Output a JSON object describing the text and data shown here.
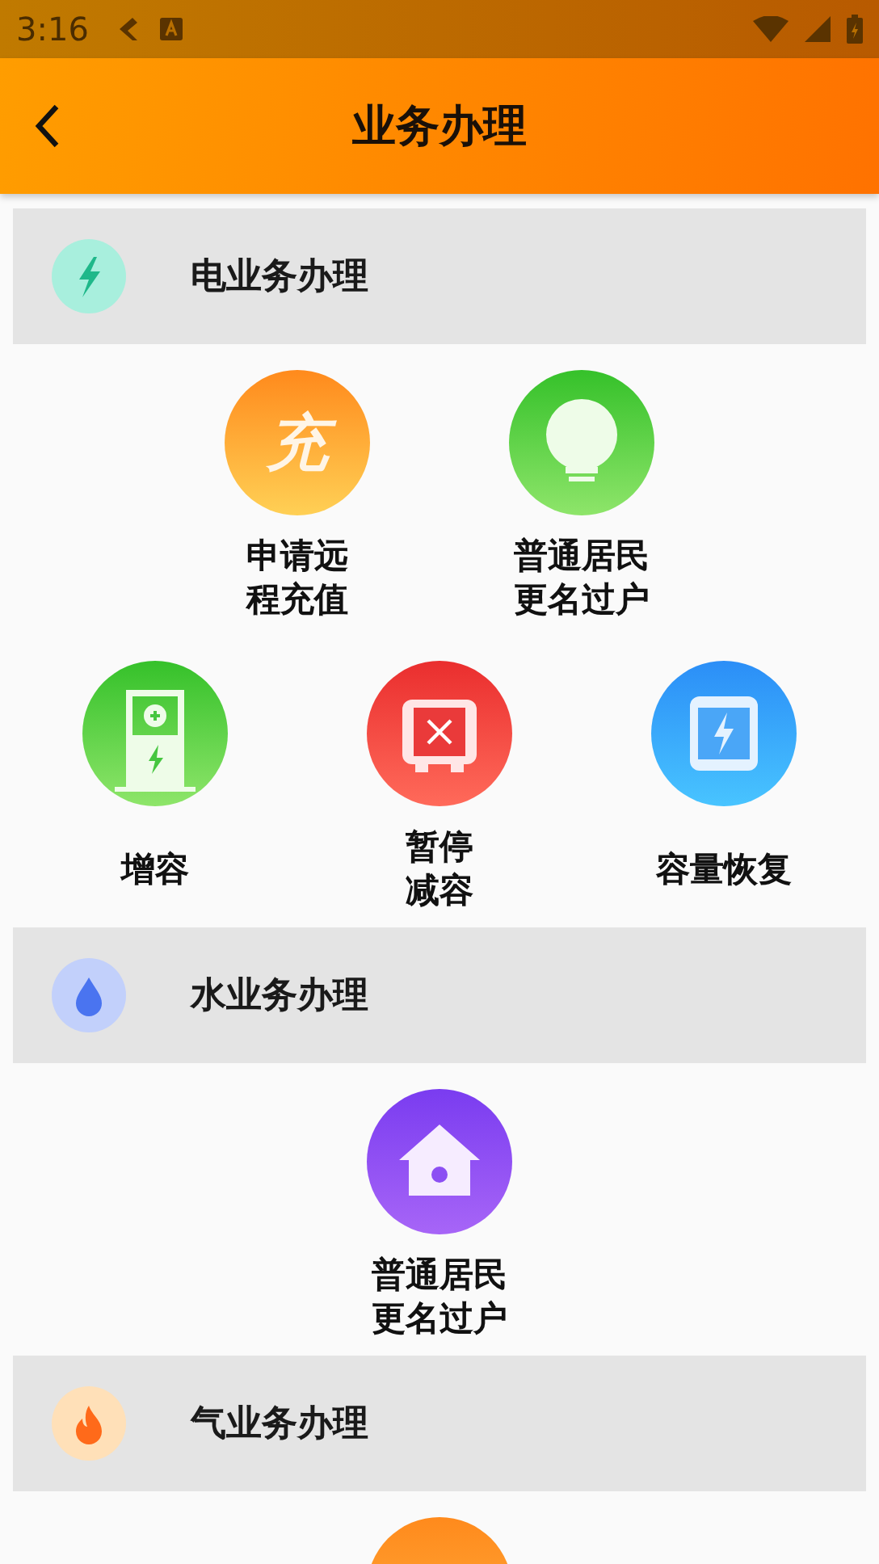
{
  "status_bar": {
    "time": "3:16"
  },
  "app_bar": {
    "title": "业务办理"
  },
  "sections": [
    {
      "title": "电业务办理",
      "kind": "bolt",
      "color": "#1fb88a",
      "rows": [
        [
          {
            "label": "申请远程充值",
            "wrap": true,
            "kind": "charge",
            "glyph": "充"
          },
          {
            "label": "普通居民更名过户",
            "wrap": true,
            "kind": "bulb"
          }
        ],
        [
          {
            "label": "增容",
            "wrap": false,
            "kind": "meter"
          },
          {
            "label": "暂停减容",
            "wrap": true,
            "kind": "pause"
          },
          {
            "label": "容量恢复",
            "wrap": false,
            "kind": "restore"
          }
        ]
      ]
    },
    {
      "title": "水业务办理",
      "kind": "drop",
      "color": "#4a74f0",
      "rows": [
        [
          {
            "label": "普通居民更名过户",
            "wrap": true,
            "kind": "house"
          }
        ]
      ]
    },
    {
      "title": "气业务办理",
      "kind": "flame",
      "color": "#ff6a1a",
      "rows": [
        [
          {
            "kind": "partial"
          }
        ]
      ]
    }
  ]
}
